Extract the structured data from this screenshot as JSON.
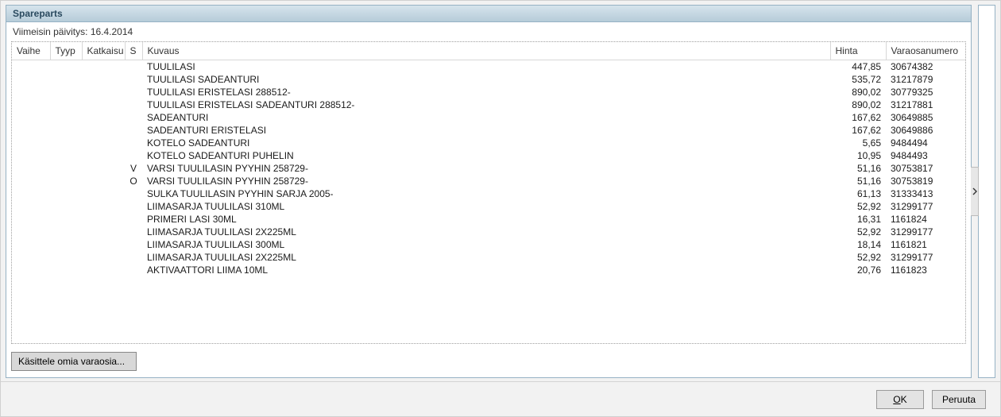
{
  "panel": {
    "title": "Spareparts",
    "updated_prefix": "Viimeisin päivitys: ",
    "updated_value": "16.4.2014"
  },
  "columns": {
    "vaihe": "Vaihe",
    "tyyp": "Tyyp",
    "katkaisu": "Katkaisu",
    "s": "S",
    "kuvaus": "Kuvaus",
    "hinta": "Hinta",
    "varaosa": "Varaosanumero"
  },
  "rows": [
    {
      "vaihe": "",
      "tyyp": "",
      "katkaisu": "",
      "s": "",
      "kuvaus": "TUULILASI",
      "hinta": "447,85",
      "varaosa": "30674382"
    },
    {
      "vaihe": "",
      "tyyp": "",
      "katkaisu": "",
      "s": "",
      "kuvaus": "TUULILASI SADEANTURI",
      "hinta": "535,72",
      "varaosa": "31217879"
    },
    {
      "vaihe": "",
      "tyyp": "",
      "katkaisu": "",
      "s": "",
      "kuvaus": "TUULILASI ERISTELASI 288512-",
      "hinta": "890,02",
      "varaosa": "30779325"
    },
    {
      "vaihe": "",
      "tyyp": "",
      "katkaisu": "",
      "s": "",
      "kuvaus": "TUULILASI ERISTELASI SADEANTURI 288512-",
      "hinta": "890,02",
      "varaosa": "31217881"
    },
    {
      "vaihe": "",
      "tyyp": "",
      "katkaisu": "",
      "s": "",
      "kuvaus": "SADEANTURI",
      "hinta": "167,62",
      "varaosa": "30649885"
    },
    {
      "vaihe": "",
      "tyyp": "",
      "katkaisu": "",
      "s": "",
      "kuvaus": "SADEANTURI ERISTELASI",
      "hinta": "167,62",
      "varaosa": "30649886"
    },
    {
      "vaihe": "",
      "tyyp": "",
      "katkaisu": "",
      "s": "",
      "kuvaus": "KOTELO SADEANTURI",
      "hinta": "5,65",
      "varaosa": "9484494"
    },
    {
      "vaihe": "",
      "tyyp": "",
      "katkaisu": "",
      "s": "",
      "kuvaus": "KOTELO SADEANTURI PUHELIN",
      "hinta": "10,95",
      "varaosa": "9484493"
    },
    {
      "vaihe": "",
      "tyyp": "",
      "katkaisu": "",
      "s": "V",
      "kuvaus": "VARSI TUULILASIN PYYHIN 258729-",
      "hinta": "51,16",
      "varaosa": "30753817"
    },
    {
      "vaihe": "",
      "tyyp": "",
      "katkaisu": "",
      "s": "O",
      "kuvaus": "VARSI TUULILASIN PYYHIN 258729-",
      "hinta": "51,16",
      "varaosa": "30753819"
    },
    {
      "vaihe": "",
      "tyyp": "",
      "katkaisu": "",
      "s": "",
      "kuvaus": "SULKA TUULILASIN PYYHIN SARJA 2005-",
      "hinta": "61,13",
      "varaosa": "31333413"
    },
    {
      "vaihe": "",
      "tyyp": "",
      "katkaisu": "",
      "s": "",
      "kuvaus": "LIIMASARJA TUULILASI 310ML",
      "hinta": "52,92",
      "varaosa": "31299177"
    },
    {
      "vaihe": "",
      "tyyp": "",
      "katkaisu": "",
      "s": "",
      "kuvaus": "PRIMERI LASI 30ML",
      "hinta": "16,31",
      "varaosa": "1161824"
    },
    {
      "vaihe": "",
      "tyyp": "",
      "katkaisu": "",
      "s": "",
      "kuvaus": "LIIMASARJA TUULILASI 2X225ML",
      "hinta": "52,92",
      "varaosa": "31299177"
    },
    {
      "vaihe": "",
      "tyyp": "",
      "katkaisu": "",
      "s": "",
      "kuvaus": "LIIMASARJA TUULILASI 300ML",
      "hinta": "18,14",
      "varaosa": "1161821"
    },
    {
      "vaihe": "",
      "tyyp": "",
      "katkaisu": "",
      "s": "",
      "kuvaus": "LIIMASARJA TUULILASI 2X225ML",
      "hinta": "52,92",
      "varaosa": "31299177"
    },
    {
      "vaihe": "",
      "tyyp": "",
      "katkaisu": "",
      "s": "",
      "kuvaus": "AKTIVAATTORI LIIMA 10ML",
      "hinta": "20,76",
      "varaosa": "1161823"
    }
  ],
  "buttons": {
    "own_spareparts": "Käsittele omia varaosia...",
    "ok": "OK",
    "ok_ul": "O",
    "ok_rest": "K",
    "cancel": "Peruuta"
  }
}
